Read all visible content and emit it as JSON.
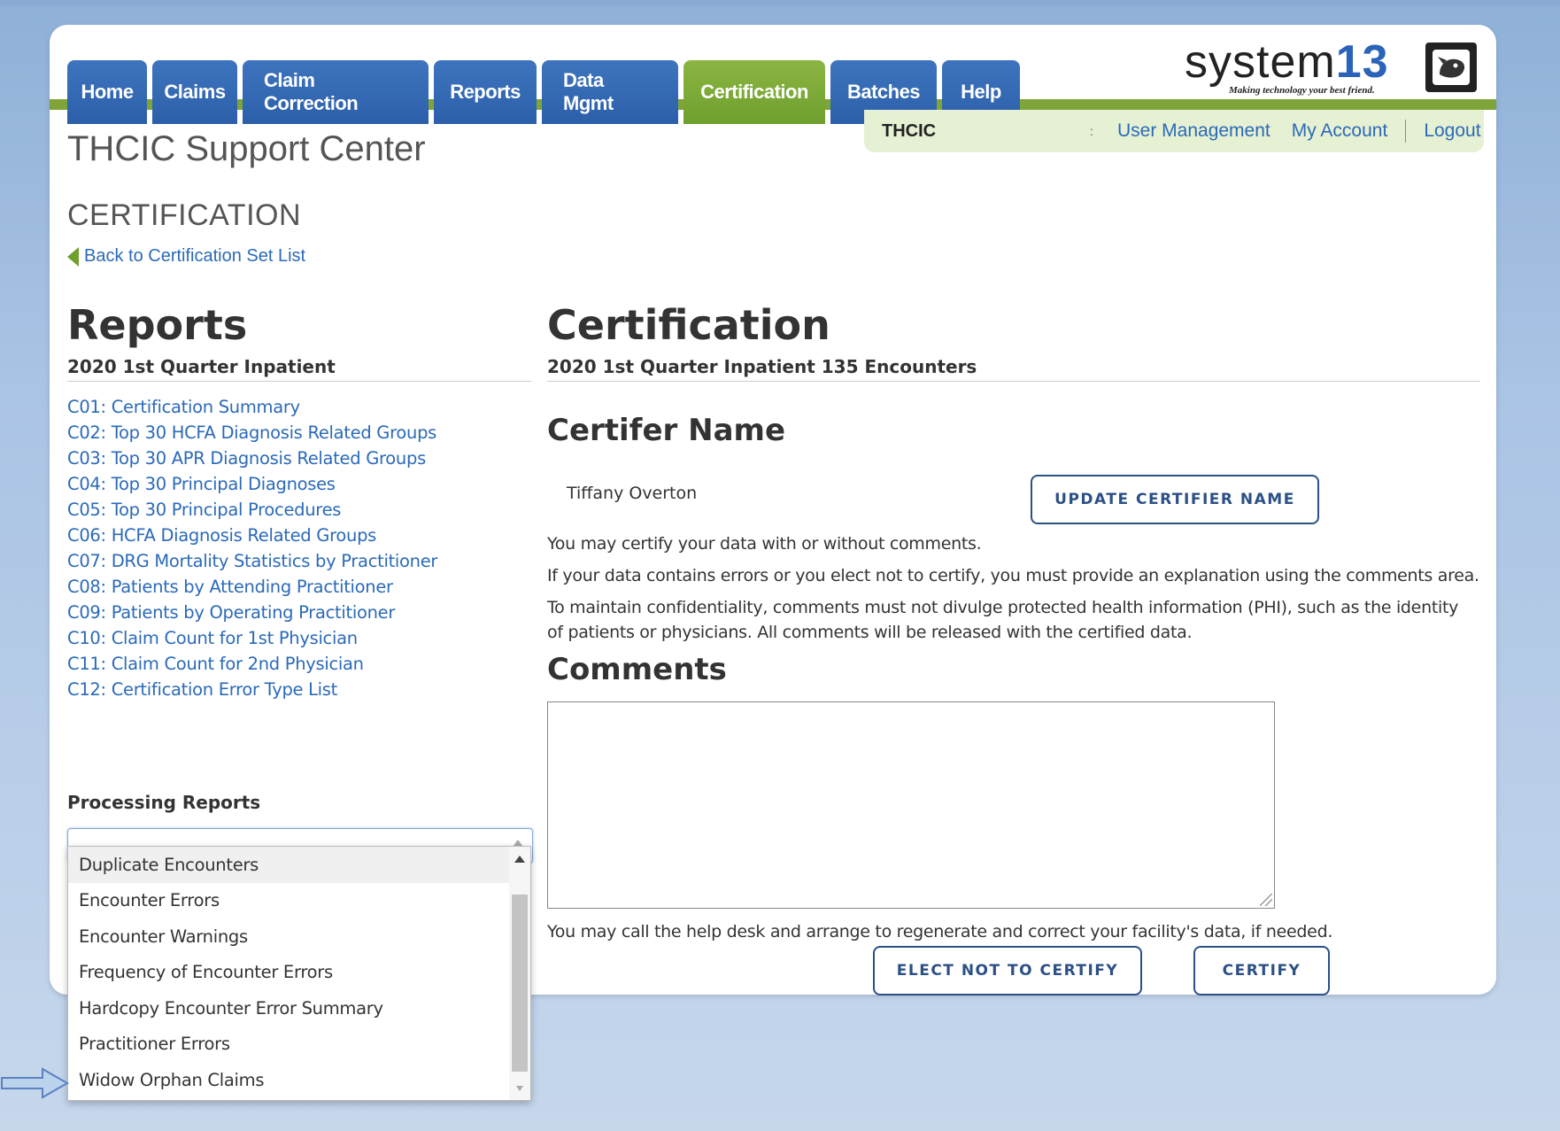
{
  "header_fragment": "",
  "nav": {
    "tabs": [
      {
        "label": "Home",
        "active": false
      },
      {
        "label": "Claims",
        "active": false
      },
      {
        "label": "Claim Correction",
        "active": false
      },
      {
        "label": "Reports",
        "active": false
      },
      {
        "label": "Data Mgmt",
        "active": false
      },
      {
        "label": "Certification",
        "active": true
      },
      {
        "label": "Batches",
        "active": false
      },
      {
        "label": "Help",
        "active": false
      }
    ]
  },
  "logo": {
    "text_main": "system",
    "text_num": "13",
    "tagline": "Making technology your best friend."
  },
  "util_bar": {
    "org": "THCIC",
    "separator": ":",
    "user_management": "User Management",
    "my_account": "My Account",
    "logout": "Logout"
  },
  "page": {
    "title": "THCIC Support Center",
    "section": "CERTIFICATION",
    "back_link": "Back to Certification Set List"
  },
  "reports": {
    "heading": "Reports",
    "subheading": "2020 1st Quarter Inpatient",
    "items": [
      "C01: Certification Summary",
      "C02: Top 30 HCFA Diagnosis Related Groups",
      "C03: Top 30 APR Diagnosis Related Groups",
      "C04: Top 30 Principal Diagnoses",
      "C05: Top 30 Principal Procedures",
      "C06: HCFA Diagnosis Related Groups",
      "C07: DRG Mortality Statistics by Practitioner",
      "C08: Patients by Attending Practitioner",
      "C09: Patients by Operating Practitioner",
      "C10: Claim Count for 1st Physician",
      "C11: Claim Count for 2nd Physician",
      "C12: Certification Error Type List"
    ],
    "processing_heading": "Processing Reports",
    "processing_selected": "",
    "processing_options": [
      "Duplicate Encounters",
      "Encounter Errors",
      "Encounter Warnings",
      "Frequency of Encounter Errors",
      "Hardcopy Encounter Error Summary",
      "Practitioner Errors",
      "Widow Orphan Claims"
    ]
  },
  "certification": {
    "heading": "Certification",
    "subheading": "2020 1st Quarter Inpatient 135 Encounters",
    "certifier_heading": "Certifer Name",
    "certifier_name": "Tiffany Overton",
    "update_button": "UPDATE CERTIFIER NAME",
    "para1": "You may certify your data with or without comments.",
    "para2": "If your data contains errors or you elect not to certify, you must provide an explanation using the comments area.",
    "para3": "To maintain confidentiality, comments must not divulge protected health information (PHI), such as the identity of patients or physicians. All comments will be released with the certified data.",
    "comments_heading": "Comments",
    "comments_value": "",
    "help_note": "You may call the help desk and arrange to regenerate and correct your facility's data, if needed.",
    "elect_not_button": "ELECT NOT TO CERTIFY",
    "certify_button": "CERTIFY"
  },
  "colors": {
    "nav_blue": "#2c5fa9",
    "nav_active_green": "#7ea43a",
    "link_blue": "#2b6ab8",
    "button_border": "#2c4f86"
  }
}
